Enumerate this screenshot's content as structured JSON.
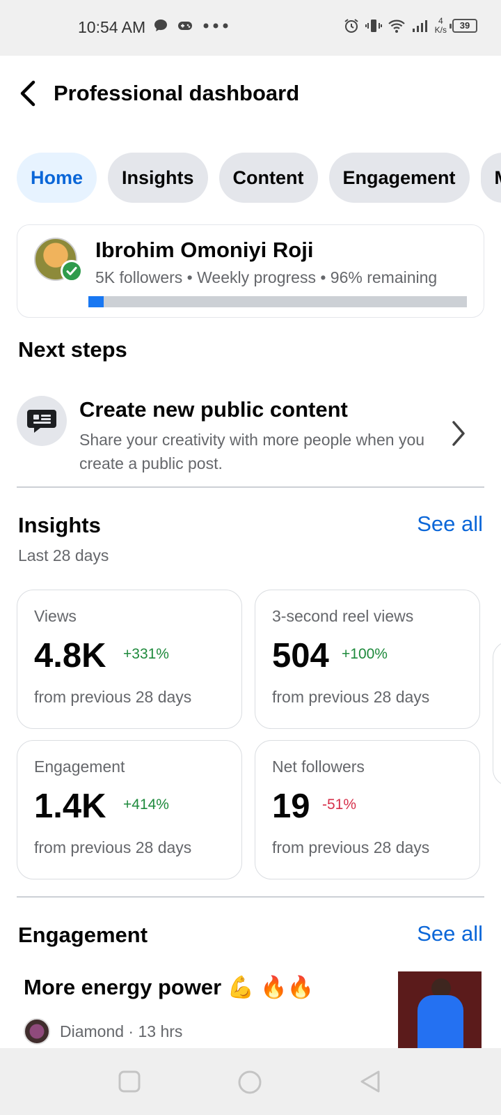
{
  "status_bar": {
    "time": "10:54 AM",
    "network_speed_value": "4",
    "network_speed_unit": "K/s",
    "battery": "39",
    "left_icons": [
      "chat-bubble-icon",
      "game-controller-icon",
      "more-dots-icon"
    ],
    "right_icons": [
      "alarm-icon",
      "vibrate-icon",
      "wifi-icon",
      "signal-icon",
      "battery-icon"
    ]
  },
  "header": {
    "title": "Professional dashboard",
    "back_icon": "back-arrow-icon"
  },
  "tabs": [
    {
      "label": "Home",
      "active": true
    },
    {
      "label": "Insights",
      "active": false
    },
    {
      "label": "Content",
      "active": false
    },
    {
      "label": "Engagement",
      "active": false
    },
    {
      "label": "M",
      "active": false
    }
  ],
  "profile": {
    "name": "Ibrohim Omoniyi Roji",
    "meta": "5K followers • Weekly progress • 96% remaining",
    "progress_fraction": 0.04
  },
  "next_steps": {
    "title": "Next steps",
    "item": {
      "title": "Create new public content",
      "description": "Share your creativity with more people when you create a public post.",
      "icon": "post-content-icon"
    }
  },
  "insights": {
    "title": "Insights",
    "see_all": "See all",
    "period": "Last 28 days",
    "metrics": [
      {
        "label": "Views",
        "value": "4.8K",
        "change": "+331%",
        "trend": "up",
        "footnote": "from previous 28 days"
      },
      {
        "label": "3-second reel views",
        "value": "504",
        "change": "+100%",
        "trend": "up",
        "footnote": "from previous 28 days"
      },
      {
        "label": "Engagement",
        "value": "1.4K",
        "change": "+414%",
        "trend": "up",
        "footnote": "from previous 28 days"
      },
      {
        "label": "Net followers",
        "value": "19",
        "change": "-51%",
        "trend": "down",
        "footnote": "from previous 28 days"
      }
    ]
  },
  "engagement": {
    "title": "Engagement",
    "see_all": "See all",
    "post": {
      "title": "More energy power 💪 🔥🔥",
      "author_meta": "Diamond · 13 hrs"
    }
  },
  "colors": {
    "accent": "#0a66d8",
    "positive": "#1e8a3c",
    "negative": "#d6314b"
  },
  "nav_bar": [
    "recent-apps-icon",
    "home-icon",
    "back-triangle-icon"
  ]
}
